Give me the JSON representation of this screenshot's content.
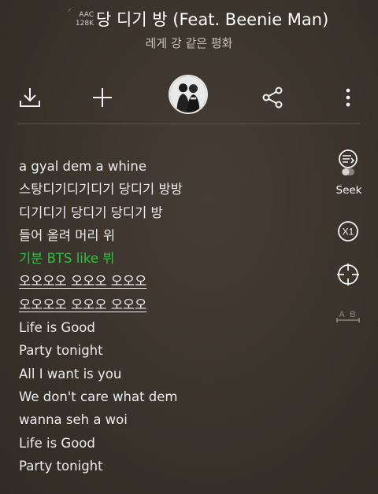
{
  "header": {
    "quality_line1": "AAC",
    "quality_line2": "128K",
    "song_title": "당 디기 방 (Feat. Beenie Man)",
    "artist": "레게 강 같은 평화"
  },
  "toolbar": {
    "download_icon": "download-icon",
    "add_icon": "plus-icon",
    "share_icon": "share-icon",
    "more_icon": "more-vertical-icon"
  },
  "side_controls": {
    "seek_label": "Seek",
    "speed_label": "X1",
    "ab_label": "A B"
  },
  "lyrics": [
    "a gyal dem a whine",
    "스탕디기디기디기 당디기 방방",
    "디기디기 당디기 당디기 방",
    "들어 올려 머리 위",
    "기분 BTS like 뷔",
    "오오오오 오오오 오오오",
    "오오오오 오오오 오오오",
    "Life is Good",
    "Party tonight",
    "All I want is you",
    "We don't care what dem",
    "wanna seh a woi",
    "Life is Good",
    "Party tonight"
  ],
  "colors": {
    "active_lyric": "#34c03f",
    "background": "#3b342d"
  }
}
